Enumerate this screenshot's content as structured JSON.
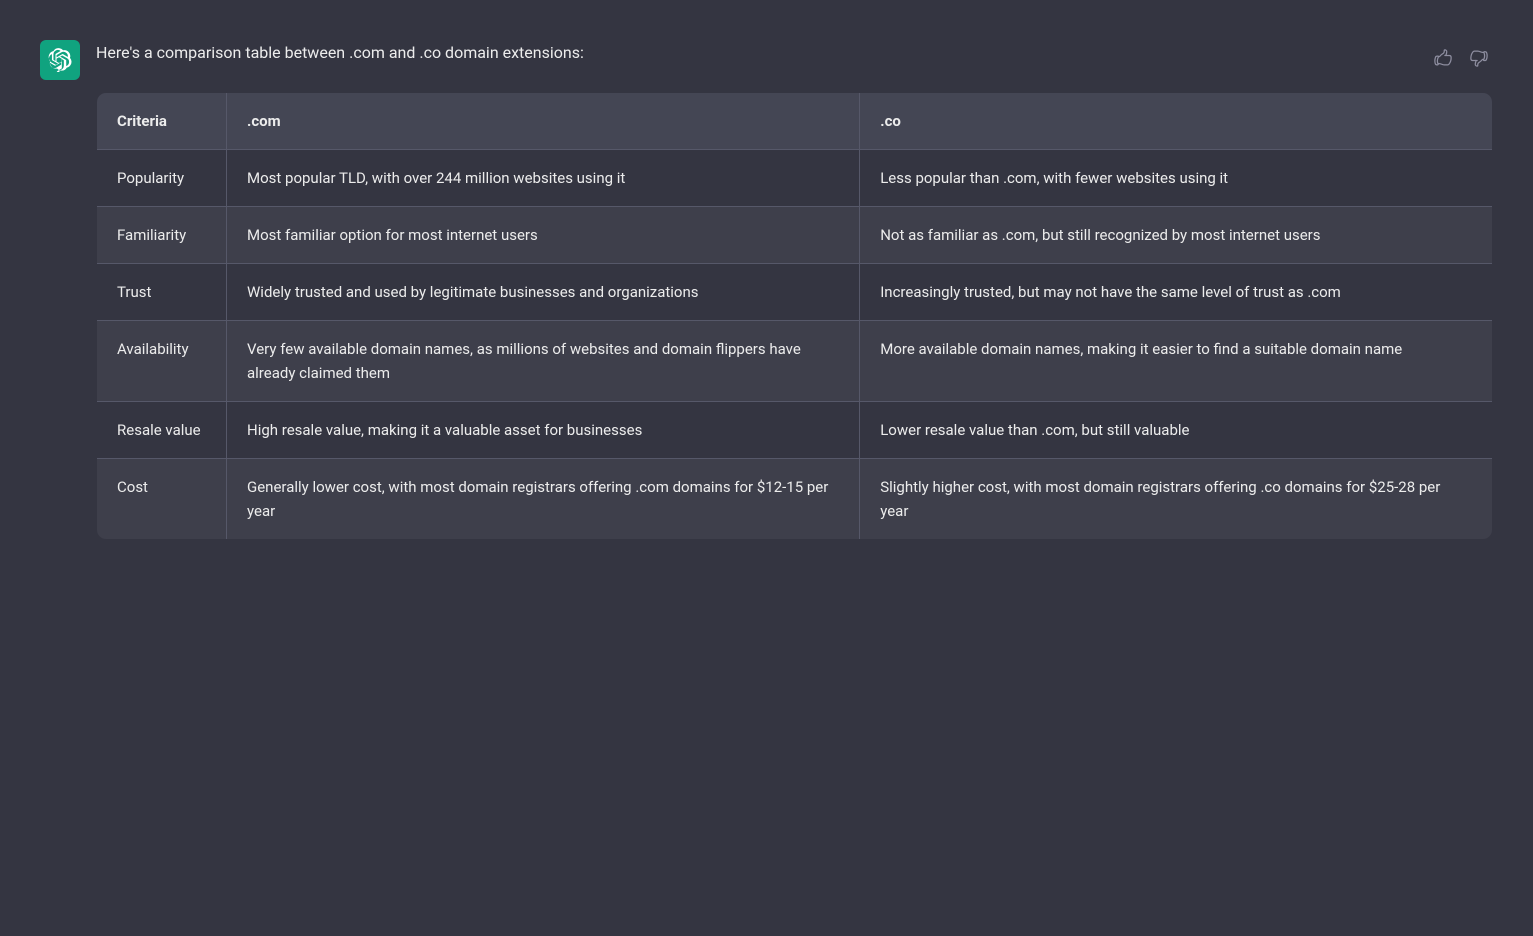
{
  "message": {
    "intro": "Here's a comparison table between .com and .co domain extensions:",
    "feedback": {
      "thumbs_up_label": "Thumbs up",
      "thumbs_down_label": "Thumbs down"
    }
  },
  "table": {
    "headers": {
      "criteria": "Criteria",
      "com": ".com",
      "co": ".co"
    },
    "rows": [
      {
        "criteria": "Popularity",
        "com": "Most popular TLD, with over 244 million websites using it",
        "co": "Less popular than .com, with fewer websites using it"
      },
      {
        "criteria": "Familiarity",
        "com": "Most familiar option for most internet users",
        "co": "Not as familiar as .com, but still recognized by most internet users"
      },
      {
        "criteria": "Trust",
        "com": "Widely trusted and used by legitimate businesses and organizations",
        "co": "Increasingly trusted, but may not have the same level of trust as .com"
      },
      {
        "criteria": "Availability",
        "com": "Very few available domain names, as millions of websites and domain flippers have already claimed them",
        "co": "More available domain names, making it easier to find a suitable domain name"
      },
      {
        "criteria": "Resale value",
        "com": "High resale value, making it a valuable asset for businesses",
        "co": "Lower resale value than .com, but still valuable"
      },
      {
        "criteria": "Cost",
        "com": "Generally lower cost, with most domain registrars offering .com domains for $12-15 per year",
        "co": "Slightly higher cost, with most domain registrars offering .co domains for $25-28 per year"
      }
    ]
  }
}
